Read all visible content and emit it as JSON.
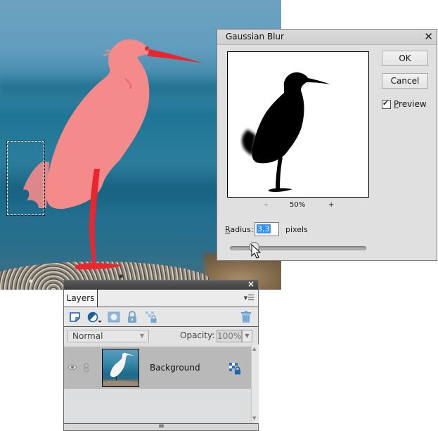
{
  "canvas": {
    "description": "Photo of white egret on rock with sea background; bird masked in red overlay",
    "selection_marquee": "rectangular selection"
  },
  "blur_dialog": {
    "title": "Gaussian Blur",
    "close_icon": "close-icon",
    "preview_zoom": {
      "minus": "–",
      "level": "50%",
      "plus": "+"
    },
    "ok_label": "OK",
    "cancel_label": "Cancel",
    "preview_label": "Preview",
    "preview_checked": true,
    "radius_label": "Radius:",
    "radius_value": "3,3",
    "radius_unit": "pixels",
    "slider_fraction": 0.18
  },
  "layers_panel": {
    "close_icon": "close-icon",
    "tab_label": "Layers",
    "menu_icon": "panel-menu-icon",
    "toolbar_icons": [
      "new-layer-icon",
      "adjustment-layer-icon",
      "layer-mask-icon",
      "lock-all-icon",
      "lock-transparency-icon",
      "trash-icon"
    ],
    "blend_mode": "Normal",
    "opacity_label": "Opacity:",
    "opacity_value": "100%",
    "layers": [
      {
        "name": "Background",
        "visible": true,
        "locked": true
      }
    ],
    "grip": "IIIIIIIII"
  },
  "colors": {
    "mask_overlay": "#ff7f7f",
    "selection_highlight": "#3390ff",
    "panel_header": "#4a4a4a"
  }
}
